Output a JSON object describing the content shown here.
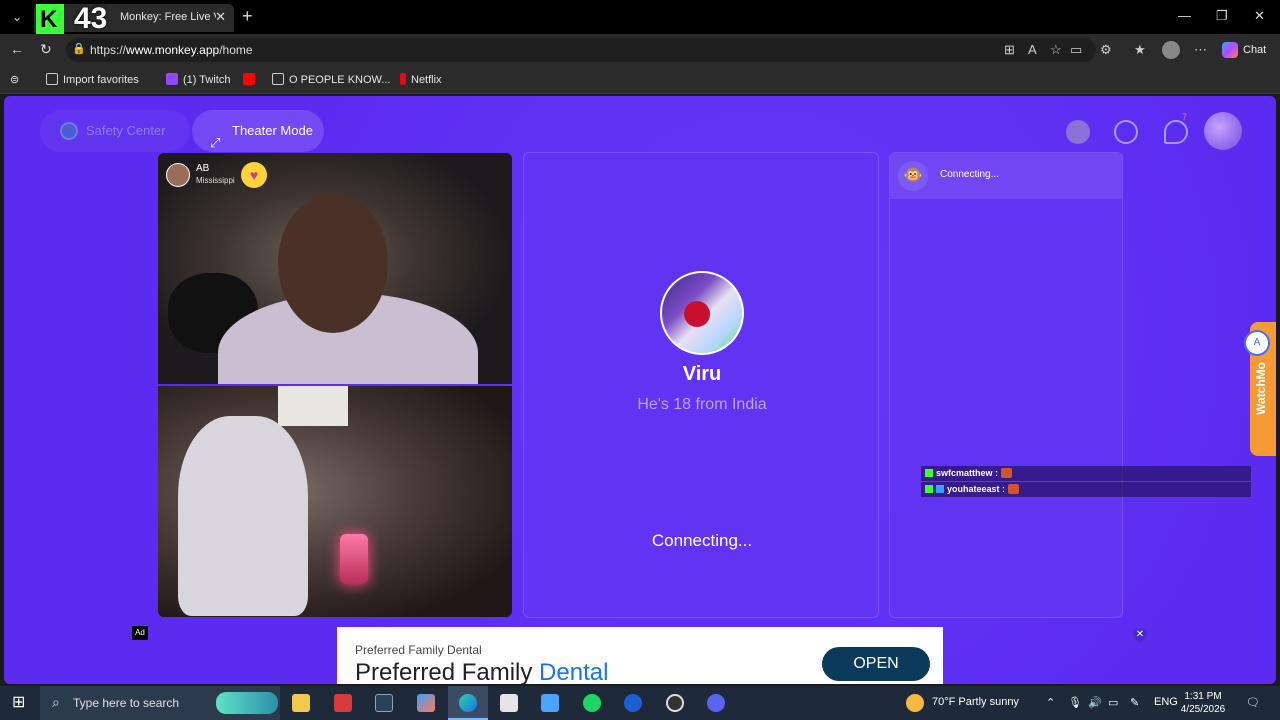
{
  "browser": {
    "tab_title": "Monkey: Free Live Video Chat",
    "overlay_badge_number": "43",
    "url_prefix": "https://",
    "url_host": "www.monkey.app",
    "url_path": "/home",
    "chat_label": "Chat",
    "favorites": [
      {
        "label": "Import favorites"
      },
      {
        "label": "(1) Twitch"
      },
      {
        "label": ""
      },
      {
        "label": "O PEOPLE KNOW..."
      },
      {
        "label": "Netflix"
      }
    ]
  },
  "page": {
    "safety_center": "Safety Center",
    "theater_mode": "Theater Mode",
    "notification_count": "7",
    "local_user": {
      "name": "AB",
      "location": "Mississippi"
    },
    "match": {
      "name": "Viru",
      "subtitle": "He's 18 from India",
      "status": "Connecting..."
    },
    "chat_panel": {
      "status": "Connecting..."
    },
    "side_widget": "WatchMo",
    "overlay_chat": [
      {
        "user": "swfcmatthew :"
      },
      {
        "user": "youhateeast :"
      }
    ]
  },
  "ad": {
    "label": "Ad",
    "small": "Preferred Family Dental",
    "big_prefix": "Preferred Family ",
    "big_highlight": "Dental",
    "button": "OPEN"
  },
  "taskbar": {
    "search_placeholder": "Type here to search",
    "weather": "70°F  Partly sunny",
    "language": "ENG",
    "time": "1:31 PM",
    "date": "4/25/2026"
  },
  "colors": {
    "page_bg": "#5b2cf0",
    "accent_green": "#3cff3c"
  }
}
